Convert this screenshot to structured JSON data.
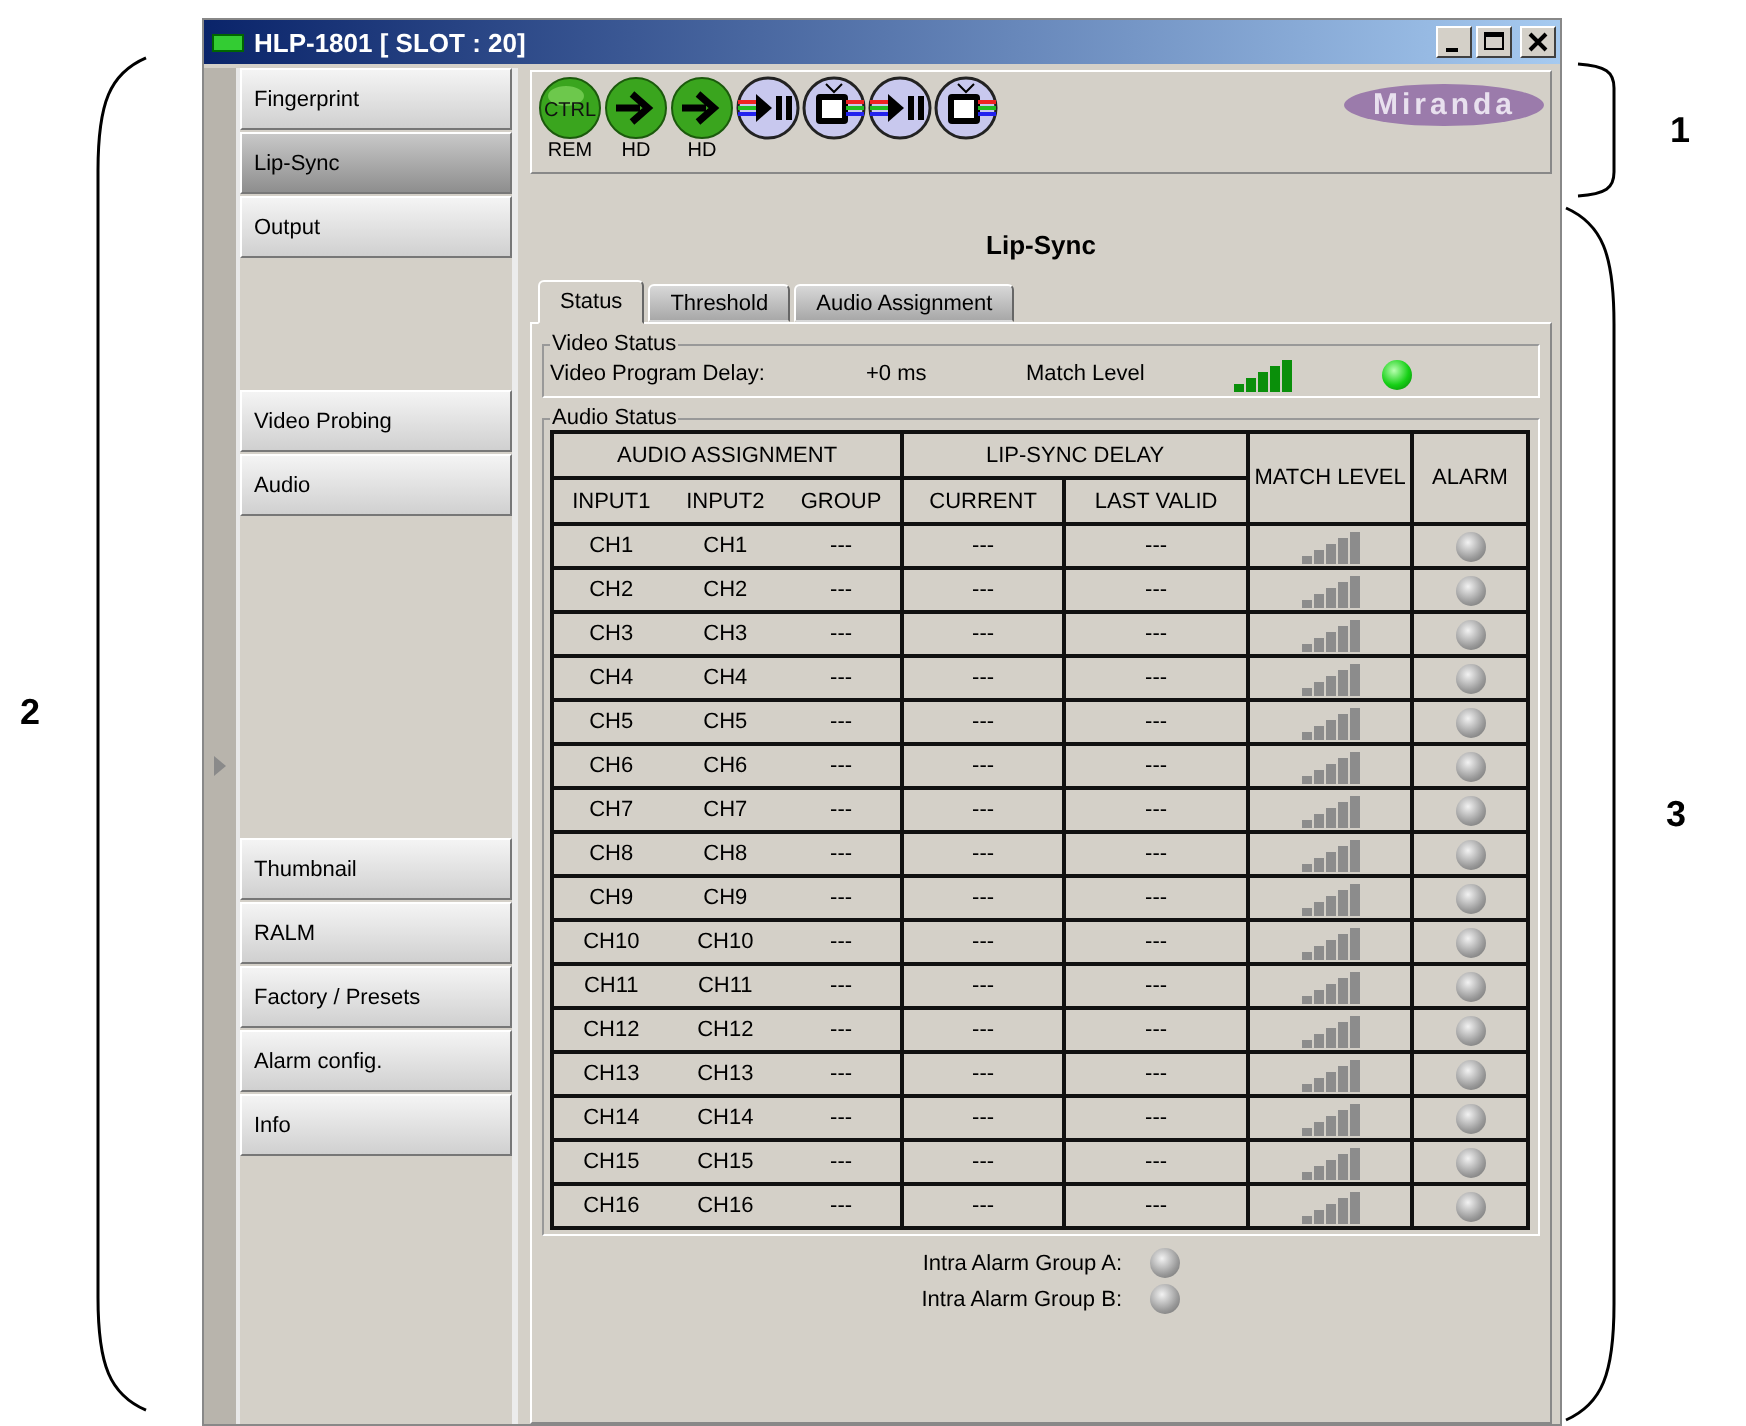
{
  "window": {
    "title": "HLP-1801 [ SLOT : 20]"
  },
  "sidebar": {
    "groups": [
      [
        {
          "label": "Fingerprint",
          "selected": false
        },
        {
          "label": "Lip-Sync",
          "selected": true
        },
        {
          "label": "Output",
          "selected": false
        }
      ],
      [
        {
          "label": "Video Probing",
          "selected": false
        },
        {
          "label": "Audio",
          "selected": false
        }
      ],
      [
        {
          "label": "Thumbnail",
          "selected": false
        },
        {
          "label": "RALM",
          "selected": false
        },
        {
          "label": "Factory / Presets",
          "selected": false
        },
        {
          "label": "Alarm config.",
          "selected": false
        },
        {
          "label": "Info",
          "selected": false
        }
      ]
    ]
  },
  "toolbar": {
    "icons": [
      {
        "kind": "ctrl",
        "text": "CTRL",
        "label": "REM"
      },
      {
        "kind": "input",
        "label": "HD"
      },
      {
        "kind": "input",
        "label": "HD"
      },
      {
        "kind": "play"
      },
      {
        "kind": "monitor"
      },
      {
        "kind": "play"
      },
      {
        "kind": "monitor"
      }
    ],
    "logo": "Miranda"
  },
  "page_title": "Lip-Sync",
  "tabs": [
    {
      "label": "Status",
      "selected": true
    },
    {
      "label": "Threshold",
      "selected": false
    },
    {
      "label": "Audio Assignment",
      "selected": false
    }
  ],
  "video_status": {
    "legend": "Video Status",
    "delay_label": "Video Program Delay:",
    "delay_value": "+0 ms",
    "match_label": "Match Level",
    "matched": true,
    "alarm_on": true
  },
  "audio_status": {
    "legend": "Audio Status",
    "header_groups": [
      "AUDIO ASSIGNMENT",
      "LIP-SYNC DELAY"
    ],
    "columns": [
      "INPUT1",
      "INPUT2",
      "GROUP",
      "CURRENT",
      "LAST VALID",
      "MATCH LEVEL",
      "ALARM"
    ],
    "rows": [
      {
        "input1": "CH1",
        "input2": "CH1",
        "group": "---",
        "current": "---",
        "last_valid": "---",
        "matched": false,
        "alarm_on": false
      },
      {
        "input1": "CH2",
        "input2": "CH2",
        "group": "---",
        "current": "---",
        "last_valid": "---",
        "matched": false,
        "alarm_on": false
      },
      {
        "input1": "CH3",
        "input2": "CH3",
        "group": "---",
        "current": "---",
        "last_valid": "---",
        "matched": false,
        "alarm_on": false
      },
      {
        "input1": "CH4",
        "input2": "CH4",
        "group": "---",
        "current": "---",
        "last_valid": "---",
        "matched": false,
        "alarm_on": false
      },
      {
        "input1": "CH5",
        "input2": "CH5",
        "group": "---",
        "current": "---",
        "last_valid": "---",
        "matched": false,
        "alarm_on": false
      },
      {
        "input1": "CH6",
        "input2": "CH6",
        "group": "---",
        "current": "---",
        "last_valid": "---",
        "matched": false,
        "alarm_on": false
      },
      {
        "input1": "CH7",
        "input2": "CH7",
        "group": "---",
        "current": "---",
        "last_valid": "---",
        "matched": false,
        "alarm_on": false
      },
      {
        "input1": "CH8",
        "input2": "CH8",
        "group": "---",
        "current": "---",
        "last_valid": "---",
        "matched": false,
        "alarm_on": false
      },
      {
        "input1": "CH9",
        "input2": "CH9",
        "group": "---",
        "current": "---",
        "last_valid": "---",
        "matched": false,
        "alarm_on": false
      },
      {
        "input1": "CH10",
        "input2": "CH10",
        "group": "---",
        "current": "---",
        "last_valid": "---",
        "matched": false,
        "alarm_on": false
      },
      {
        "input1": "CH11",
        "input2": "CH11",
        "group": "---",
        "current": "---",
        "last_valid": "---",
        "matched": false,
        "alarm_on": false
      },
      {
        "input1": "CH12",
        "input2": "CH12",
        "group": "---",
        "current": "---",
        "last_valid": "---",
        "matched": false,
        "alarm_on": false
      },
      {
        "input1": "CH13",
        "input2": "CH13",
        "group": "---",
        "current": "---",
        "last_valid": "---",
        "matched": false,
        "alarm_on": false
      },
      {
        "input1": "CH14",
        "input2": "CH14",
        "group": "---",
        "current": "---",
        "last_valid": "---",
        "matched": false,
        "alarm_on": false
      },
      {
        "input1": "CH15",
        "input2": "CH15",
        "group": "---",
        "current": "---",
        "last_valid": "---",
        "matched": false,
        "alarm_on": false
      },
      {
        "input1": "CH16",
        "input2": "CH16",
        "group": "---",
        "current": "---",
        "last_valid": "---",
        "matched": false,
        "alarm_on": false
      }
    ]
  },
  "intra_alarms": [
    {
      "label": "Intra Alarm Group A:",
      "alarm_on": false
    },
    {
      "label": "Intra Alarm Group B:",
      "alarm_on": false
    }
  ],
  "annotations": {
    "toolbar": "1",
    "sidebar": "2",
    "panel": "3"
  }
}
